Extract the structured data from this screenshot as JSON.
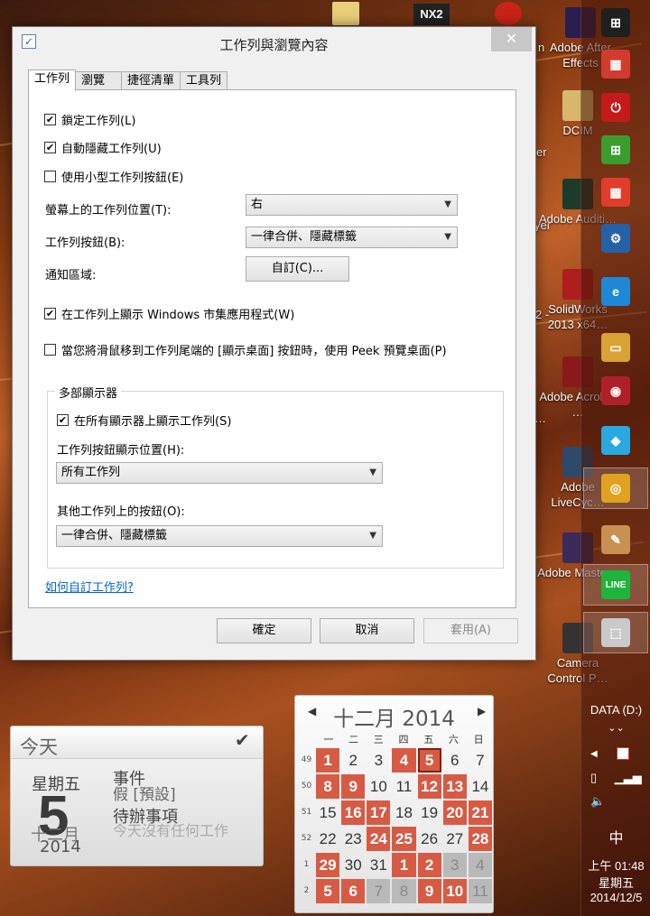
{
  "dialog": {
    "title": "工作列與瀏覽內容",
    "close_glyph": "✕",
    "tabs": [
      "工作列",
      "瀏覽",
      "捷徑清單",
      "工具列"
    ],
    "options": {
      "lock_taskbar": {
        "label": "鎖定工作列(L)",
        "checked": true
      },
      "auto_hide": {
        "label": "自動隱藏工作列(U)",
        "checked": true
      },
      "small_buttons": {
        "label": "使用小型工作列按鈕(E)",
        "checked": false
      },
      "show_store_apps": {
        "label": "在工作列上顯示 Windows 市集應用程式(W)",
        "checked": true
      },
      "peek": {
        "label": "當您將滑鼠移到工作列尾端的 [顯示桌面] 按鈕時，使用 Peek 預覽桌面(P)",
        "checked": false
      }
    },
    "position_label": "螢幕上的工作列位置(T):",
    "position_value": "右",
    "buttons_label": "工作列按鈕(B):",
    "buttons_value": "一律合併、隱藏標籤",
    "notify_label": "通知區域:",
    "customize_button": "自訂(C)...",
    "multi": {
      "group_title": "多部顯示器",
      "show_all": {
        "label": "在所有顯示器上顯示工作列(S)",
        "checked": true
      },
      "show_buttons_label": "工作列按鈕顯示位置(H):",
      "show_buttons_value": "所有工作列",
      "other_buttons_label": "其他工作列上的按鈕(O):",
      "other_buttons_value": "一律合併、隱藏標籤"
    },
    "help_link": "如何自訂工作列?",
    "ok": "確定",
    "cancel": "取消",
    "apply": "套用(A)"
  },
  "desktop_icons": [
    {
      "label": "Adobe After Effects",
      "color": "#2a1d4f"
    },
    {
      "label": "DCIM",
      "color": "#d7b86a"
    },
    {
      "label": "Adobe Auditi…",
      "color": "#1d3b2a"
    },
    {
      "label": "SolidWorks 2013 x64…",
      "color": "#b01d1d"
    },
    {
      "label": "Adobe Acrobat …",
      "color": "#8a1a1a"
    },
    {
      "label": "Adobe LiveCyc…",
      "color": "#2d4a6b"
    },
    {
      "label": "Adobe Maste…",
      "color": "#3b2a5a"
    },
    {
      "label": "Camera Control P…",
      "color": "#333333"
    }
  ],
  "desktop_partial": [
    "n",
    "er",
    "yer",
    "2 -",
    "…"
  ],
  "taskbar": {
    "apps": [
      {
        "name": "windows-icon",
        "glyph": "⊞",
        "color": "#1f1f1f"
      },
      {
        "name": "app-colorful-icon",
        "glyph": "▦",
        "color": "#d23b2f"
      },
      {
        "name": "power-icon",
        "glyph": "⏻",
        "color": "#c51a1a"
      },
      {
        "name": "store-icon",
        "glyph": "⊞",
        "color": "#3c9d2f"
      },
      {
        "name": "apps-grid-icon",
        "glyph": "▦",
        "color": "#e23c2c"
      },
      {
        "name": "remote-desktop-icon",
        "glyph": "⚙",
        "color": "#2561a7"
      },
      {
        "name": "ie-icon",
        "glyph": "e",
        "color": "#1d89d6"
      },
      {
        "name": "folder-icon",
        "glyph": "▭",
        "color": "#d9a235"
      },
      {
        "name": "network-icon",
        "glyph": "◉",
        "color": "#b0202a"
      },
      {
        "name": "shapes-icon",
        "glyph": "◆",
        "color": "#2aa8e0"
      },
      {
        "name": "chrome-icon",
        "glyph": "◎",
        "color": "#e0a321"
      },
      {
        "name": "paint-icon",
        "glyph": "✎",
        "color": "#c89052"
      },
      {
        "name": "line-icon",
        "glyph": "LINE",
        "color": "#1fb53c"
      },
      {
        "name": "pdf-icon",
        "glyph": "⬚",
        "color": "#c9c9c9"
      }
    ],
    "drive_label": "DATA (D:)",
    "ime": "中",
    "time": "上午 01:48",
    "weekday": "星期五",
    "date": "2014/12/5"
  },
  "date_gadget": {
    "today_label": "今天",
    "weekday": "星期五",
    "day": "5",
    "month": "十二月",
    "year": "2014",
    "events_heading": "事件",
    "holiday": "假 [預設]",
    "todo_heading": "待辦事項",
    "no_tasks": "今天沒有任何工作"
  },
  "calendar": {
    "title": "十二月 2014",
    "weekdays": [
      "一",
      "二",
      "三",
      "四",
      "五",
      "六",
      "日"
    ],
    "weeks": [
      {
        "num": "49",
        "days": [
          [
            "1",
            "h"
          ],
          [
            "2",
            "n"
          ],
          [
            "3",
            "n"
          ],
          [
            "4",
            "h"
          ],
          [
            "5",
            "t"
          ],
          [
            "6",
            "n"
          ],
          [
            "7",
            "n"
          ]
        ]
      },
      {
        "num": "50",
        "days": [
          [
            "8",
            "h"
          ],
          [
            "9",
            "h"
          ],
          [
            "10",
            "n"
          ],
          [
            "11",
            "n"
          ],
          [
            "12",
            "h"
          ],
          [
            "13",
            "h"
          ],
          [
            "14",
            "n"
          ]
        ]
      },
      {
        "num": "51",
        "days": [
          [
            "15",
            "n"
          ],
          [
            "16",
            "h"
          ],
          [
            "17",
            "h"
          ],
          [
            "18",
            "n"
          ],
          [
            "19",
            "n"
          ],
          [
            "20",
            "h"
          ],
          [
            "21",
            "h"
          ]
        ]
      },
      {
        "num": "52",
        "days": [
          [
            "22",
            "n"
          ],
          [
            "23",
            "n"
          ],
          [
            "24",
            "h"
          ],
          [
            "25",
            "h"
          ],
          [
            "26",
            "n"
          ],
          [
            "27",
            "n"
          ],
          [
            "28",
            "h"
          ]
        ]
      },
      {
        "num": "1",
        "days": [
          [
            "29",
            "h"
          ],
          [
            "30",
            "n"
          ],
          [
            "31",
            "n"
          ],
          [
            "1",
            "h"
          ],
          [
            "2",
            "h"
          ],
          [
            "3",
            "o"
          ],
          [
            "4",
            "o"
          ]
        ]
      },
      {
        "num": "2",
        "days": [
          [
            "5",
            "h"
          ],
          [
            "6",
            "h"
          ],
          [
            "7",
            "o"
          ],
          [
            "8",
            "o"
          ],
          [
            "9",
            "h"
          ],
          [
            "10",
            "h"
          ],
          [
            "11",
            "o"
          ]
        ]
      }
    ]
  }
}
